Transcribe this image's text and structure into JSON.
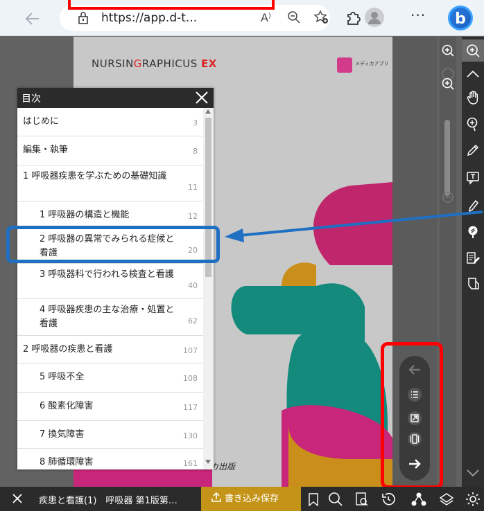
{
  "browser": {
    "url": "https://app.d-t...",
    "read_aloud_label": "A⁾",
    "more_label": "···",
    "bing_label": "b"
  },
  "page": {
    "brand_pre": "NURSIN",
    "brand_g": "G",
    "brand_post": "RAPHICUS",
    "brand_ex": "EX",
    "medica_label": "メディカアプリ",
    "publisher": "メディカ出版"
  },
  "toc": {
    "title": "目次",
    "items": [
      {
        "label": "はじめに",
        "page": "3",
        "indent": false
      },
      {
        "label": "編集・執筆",
        "page": "8",
        "indent": false
      },
      {
        "label": "1 呼吸器疾患を学ぶための基礎知識",
        "page": "11",
        "indent": false
      },
      {
        "label": "1 呼吸器の構造と機能",
        "page": "12",
        "indent": true
      },
      {
        "label": "2 呼吸器の異常でみられる症候と看護",
        "page": "20",
        "indent": true
      },
      {
        "label": "3 呼吸器科で行われる検査と看護",
        "page": "40",
        "indent": true
      },
      {
        "label": "4 呼吸器疾患の主な治療・処置と看護",
        "page": "62",
        "indent": true
      },
      {
        "label": "2 呼吸器の疾患と看護",
        "page": "107",
        "indent": false
      },
      {
        "label": "5 呼吸不全",
        "page": "108",
        "indent": true
      },
      {
        "label": "6 酸素化障害",
        "page": "117",
        "indent": true
      },
      {
        "label": "7 換気障害",
        "page": "130",
        "indent": true
      },
      {
        "label": "8 肺循環障害",
        "page": "161",
        "indent": true
      }
    ]
  },
  "status": {
    "document": "疾患と看護(1)　呼吸器 第1版第…",
    "save_label": "書き込み保存"
  },
  "colors": {
    "highlight": "#1f6fc2",
    "annotation_red": "#ff0000",
    "save_button": "#c49418"
  }
}
